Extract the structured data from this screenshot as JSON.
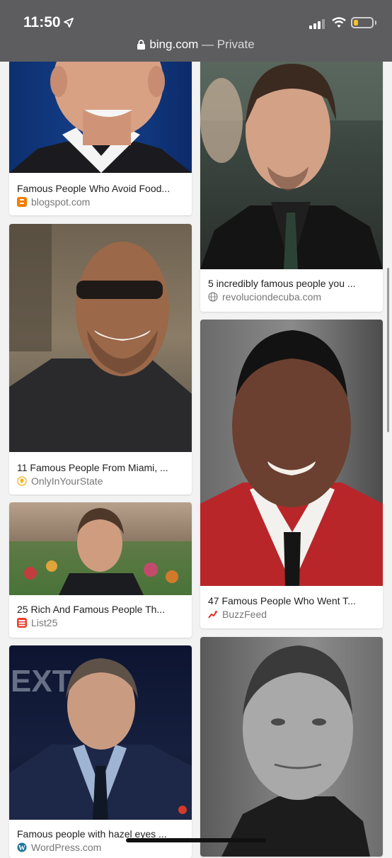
{
  "status_bar": {
    "time": "11:50",
    "url_domain": "bing.com",
    "url_suffix": " — Private"
  },
  "results": [
    {
      "caption": "Famous People Who Avoid Food...",
      "source": "blogspot.com",
      "source_icon": "blogger-icon",
      "source_icon_color": "#f57d00"
    },
    {
      "caption": "5 incredibly famous people you ...",
      "source": "revoluciondecuba.com",
      "source_icon": "globe-icon",
      "source_icon_color": "#8a8a8a"
    },
    {
      "caption": "11 Famous People From Miami, ...",
      "source": "OnlyInYourState",
      "source_icon": "location-pin-icon",
      "source_icon_color": "#f2b21b"
    },
    {
      "caption": "47 Famous People Who Went T...",
      "source": "BuzzFeed",
      "source_icon": "trending-arrow-icon",
      "source_icon_color": "#e32c2c"
    },
    {
      "caption": "25 Rich And Famous People Th...",
      "source": "List25",
      "source_icon": "list25-icon",
      "source_icon_color": "#e8402c"
    },
    {
      "caption": "",
      "source": "",
      "source_icon": "",
      "source_icon_color": ""
    },
    {
      "caption": "Famous people with hazel eyes ...",
      "source": "WordPress.com",
      "source_icon": "wordpress-icon",
      "source_icon_color": "#21759b"
    }
  ]
}
